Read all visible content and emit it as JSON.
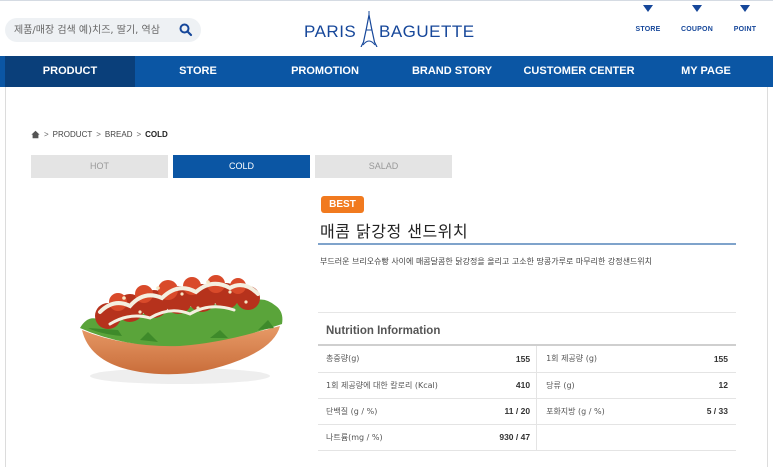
{
  "search": {
    "placeholder": "제품/매장 검색 예)치즈, 딸기, 역삼"
  },
  "logo": {
    "left_word": "PARIS",
    "right_word": "BAGUETTE"
  },
  "quick_links": [
    "STORE",
    "COUPON",
    "POINT"
  ],
  "nav": {
    "items": [
      "PRODUCT",
      "STORE",
      "PROMOTION",
      "BRAND STORY",
      "CUSTOMER CENTER",
      "MY PAGE"
    ],
    "active": "PRODUCT"
  },
  "breadcrumb": {
    "items": [
      "PRODUCT",
      "BREAD"
    ],
    "current": "COLD"
  },
  "tabs": {
    "items": [
      "HOT",
      "COLD",
      "SALAD"
    ],
    "active": "COLD"
  },
  "product": {
    "badge": "BEST",
    "name": "매콤 닭강정 샌드위치",
    "description": "부드러운 브리오슈빵 사이에 매콤달콤한 닭강정을 올리고 고소한 땅콩가루로 마무리한 강정샌드위치"
  },
  "nutrition": {
    "title": "Nutrition Information",
    "rows": [
      {
        "label": "총중량(g)",
        "value": "155",
        "label2": "1회 제공량 (g)",
        "value2": "155"
      },
      {
        "label": "1회 제공량에 대한 칼로리 (Kcal)",
        "value": "410",
        "label2": "당류 (g)",
        "value2": "12"
      },
      {
        "label": "단백질 (g / %)",
        "value": "11 / 20",
        "label2": "포화지방 (g / %)",
        "value2": "5 / 33"
      },
      {
        "label": "나트륨(mg / %)",
        "value": "930 / 47",
        "label2": "",
        "value2": ""
      }
    ]
  },
  "colors": {
    "brand_blue": "#0b56a4",
    "nav_active": "#0a3f7a",
    "badge_orange": "#f17a1f",
    "logo_blue": "#16479a"
  },
  "icons": {
    "search": "search-icon",
    "home": "home-icon",
    "quick_marker": "triangle-down-icon"
  }
}
